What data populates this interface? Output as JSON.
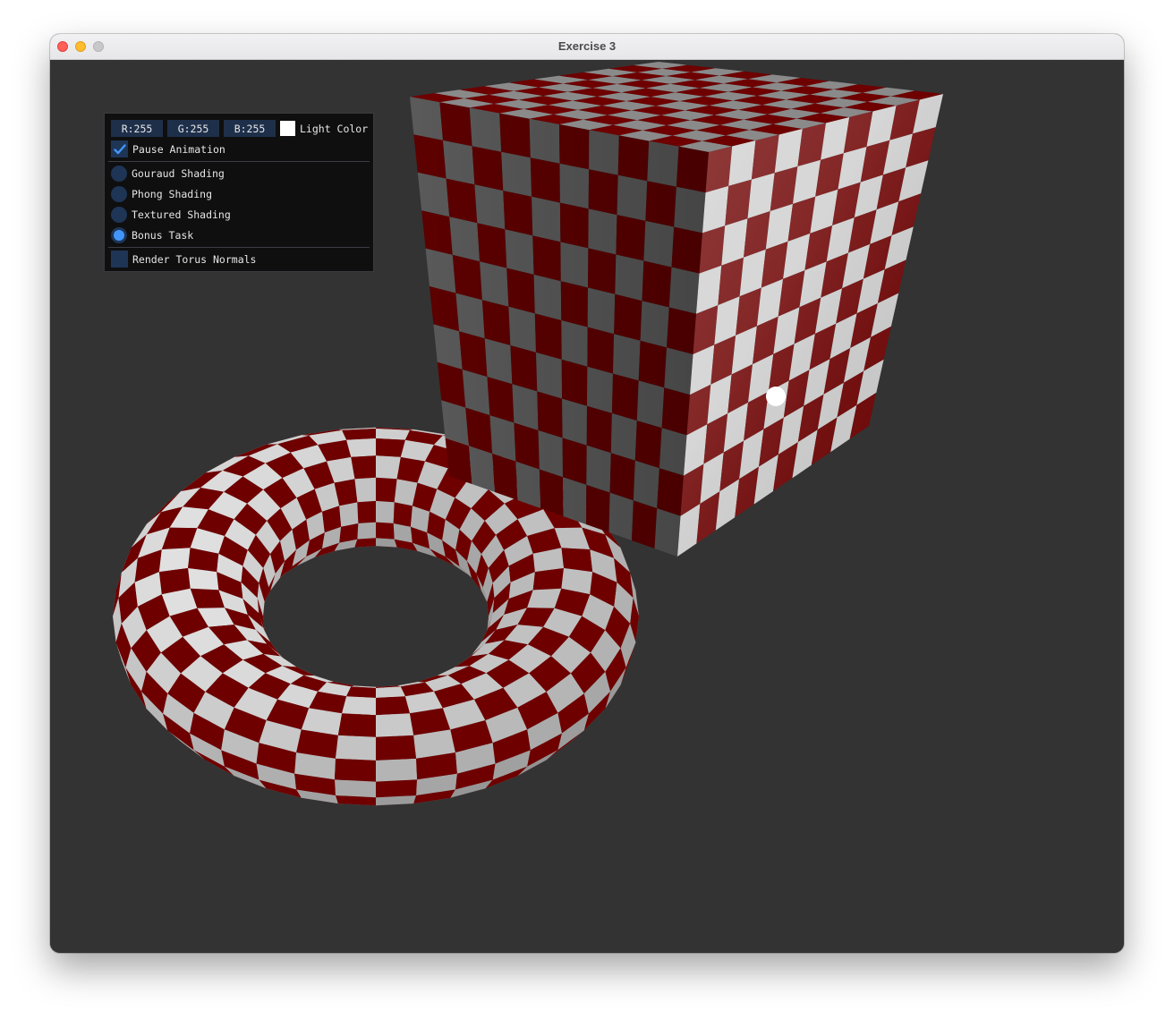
{
  "window": {
    "title": "Exercise 3"
  },
  "panel": {
    "r_label": "R:255",
    "g_label": "G:255",
    "b_label": "B:255",
    "light_color_label": "Light Color",
    "light_color": "#ffffff",
    "pause_animation_label": "Pause Animation",
    "pause_animation_checked": true,
    "shading_options": [
      {
        "label": "Gouraud Shading",
        "selected": false
      },
      {
        "label": "Phong Shading",
        "selected": false
      },
      {
        "label": "Textured Shading",
        "selected": false
      },
      {
        "label": "Bonus Task",
        "selected": true
      }
    ],
    "render_torus_normals_label": "Render Torus Normals",
    "render_torus_normals_checked": false
  },
  "colors": {
    "background": "#333333",
    "checker_red": "#6e0000",
    "checker_white": "#d8d8d8",
    "accent": "#4296fa"
  }
}
